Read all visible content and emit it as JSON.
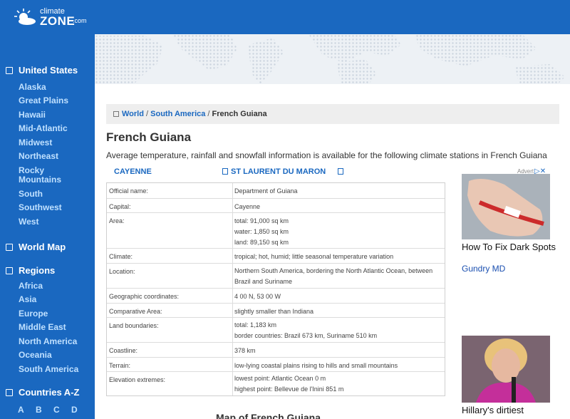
{
  "logo": {
    "line1": "climate",
    "line2": "ZONE",
    "line3": ".com"
  },
  "sidebar": {
    "united_states": "United States",
    "states": [
      "Alaska",
      "Great Plains",
      "Hawaii",
      "Mid-Atlantic",
      "Midwest",
      "Northeast",
      "Rocky",
      "Mountains",
      "South",
      "Southwest",
      "West"
    ],
    "world_map": "World Map",
    "regions": "Regions",
    "region_items": [
      "Africa",
      "Asia",
      "Europe",
      "Middle East",
      "North America",
      "Oceania",
      "South America"
    ],
    "countries": "Countries A-Z",
    "letters": [
      "A",
      "B",
      "C",
      "D"
    ]
  },
  "breadcrumb": {
    "world": "World",
    "sep1": " / ",
    "south_america": "South America",
    "sep2": " / ",
    "current": "French Guiana"
  },
  "page": {
    "title": "French Guiana",
    "intro": "Average temperature, rainfall and snowfall information is available for the following climate stations in French Guiana",
    "stations": [
      "CAYENNE",
      "ST LAURENT DU MARON"
    ],
    "map_title": "Map of French Guiana"
  },
  "info": [
    {
      "key": "Official name:",
      "lines": [
        "Department of Guiana"
      ]
    },
    {
      "key": "Capital:",
      "lines": [
        "Cayenne"
      ]
    },
    {
      "key": "Area:",
      "lines": [
        "total: 91,000 sq km",
        "water: 1,850 sq km",
        "land: 89,150 sq km"
      ]
    },
    {
      "key": "Climate:",
      "lines": [
        "tropical; hot, humid; little seasonal temperature variation"
      ]
    },
    {
      "key": "Location:",
      "lines": [
        "Northern South America, bordering the North Atlantic Ocean, between",
        "Brazil and Suriname"
      ]
    },
    {
      "key": "Geographic coordinates:",
      "lines": [
        "4 00 N, 53 00 W"
      ]
    },
    {
      "key": "Comparative Area:",
      "lines": [
        "slightly smaller than Indiana"
      ]
    },
    {
      "key": "Land boundaries:",
      "lines": [
        "total: 1,183 km",
        "border countries: Brazil 673 km, Suriname 510 km"
      ]
    },
    {
      "key": "Coastline:",
      "lines": [
        "378 km"
      ]
    },
    {
      "key": "Terrain:",
      "lines": [
        "low-lying coastal plains rising to hills and small mountains"
      ]
    },
    {
      "key": "Elevation extremes:",
      "lines": [
        "lowest point: Atlantic Ocean 0 m",
        "highest point: Bellevue de l'Inini 851 m"
      ]
    }
  ],
  "ads": {
    "label": "Advert",
    "ad1_title": "How To Fix Dark Spots",
    "ad1_source": "Gundry MD",
    "ad2_title": "Hillary's dirtiest"
  },
  "colors": {
    "brand_blue": "#1a68c0",
    "link_blue": "#1a68c0",
    "sidebar_link": "#bfe0ff"
  }
}
